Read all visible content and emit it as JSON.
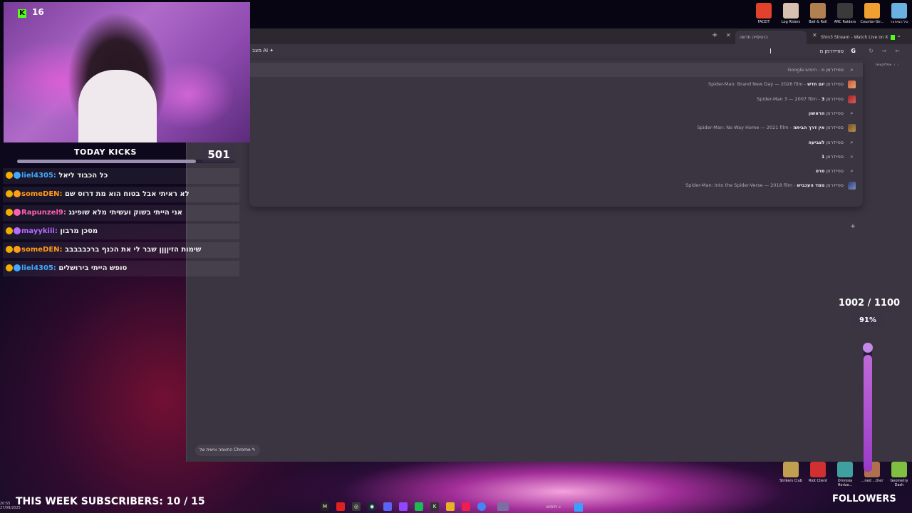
{
  "webcam": {
    "kick_count": "16"
  },
  "kicks": {
    "label": "TODAY KICKS",
    "count": "501",
    "progress": 0.82
  },
  "chat": [
    {
      "user": "liel4305:",
      "message": "כל הכבוד ליאל",
      "color": "#3fa9ff"
    },
    {
      "user": "someDEN:",
      "message": "לא ראיתי אבל בטוח הוא מת דרוס שם",
      "color": "#ff9c1a"
    },
    {
      "user": "Rapunzel9:",
      "message": "אני הייתי בשוק ועשיתי מלא שופינג",
      "color": "#ff5fb0"
    },
    {
      "user": "mayykiii:",
      "message": "מסכן מרבון",
      "color": "#b86bff"
    },
    {
      "user": "someDEN:",
      "message": "שימות הזיןןןן שבר לי את הכנף ברכבבבבב",
      "color": "#ff9c1a"
    },
    {
      "user": "liel4305:",
      "message": "סופש הייתי בירושלים",
      "color": "#3fa9ff"
    }
  ],
  "browser": {
    "tabs": [
      {
        "label": "Shin3 Stream - Watch Live on K"
      },
      {
        "label": "כרטיסייה חדשה"
      }
    ],
    "ai_mode": "מצב AI",
    "omnibox_text": "ספיידרמן מ",
    "apps_label": "אפליקציות",
    "customize": "התאמה אישית של Chrome"
  },
  "suggestions": [
    {
      "bold": "",
      "prefix": "ספיידרמן מ",
      "desc": "חיפוש Google",
      "icon": "search"
    },
    {
      "bold": "יום חדש",
      "prefix": "ספיידרמן ",
      "desc": "Spider-Man: Brand New Day — 2026 film",
      "icon": "thumb1"
    },
    {
      "bold": "3",
      "prefix": "ספיידרמן ",
      "desc": "Spider-Man 3 — 2007 film",
      "icon": "thumb2"
    },
    {
      "bold": "הראשון",
      "prefix": "ספיידרמן ",
      "desc": "",
      "icon": "search"
    },
    {
      "bold": "אין דרך הביתה",
      "prefix": "ספיידרמן ",
      "desc": "Spider-Man: No Way Home — 2021 film",
      "icon": "thumb3"
    },
    {
      "bold": "לצביעה",
      "prefix": "ספיידרמן ",
      "desc": "",
      "icon": "search"
    },
    {
      "bold": "1",
      "prefix": "ספיידרמן ",
      "desc": "",
      "icon": "search"
    },
    {
      "bold": "סרט",
      "prefix": "ספיידרמן ",
      "desc": "",
      "icon": "search"
    },
    {
      "bold": "ממד העכביש",
      "prefix": "ספיידרמן ",
      "desc": "Spider-Man: Into the Spider-Verse — 2018 film",
      "icon": "thumb4"
    }
  ],
  "desktop_icons_top": [
    "FACEIT",
    "Log Riders",
    "Ball & Roll",
    "ARC Raiders",
    "Counter-Str...",
    "סל המיחזור"
  ],
  "desktop_icons_bottom": [
    "Strikers Club",
    "Riot Client",
    "Omnisia Horizo...",
    "...ned ...ther",
    "Geometry Dash"
  ],
  "goal": {
    "count": "1002 / 1100",
    "percent": "91%",
    "fraction": 0.91
  },
  "followers_label": "FOLLOWERS",
  "subs_label": "THIS WEEK SUBSCRIBERS: 10 / 15",
  "taskbar": {
    "search": "חיפוש",
    "time": "20:55",
    "date": "27/08/2025"
  }
}
